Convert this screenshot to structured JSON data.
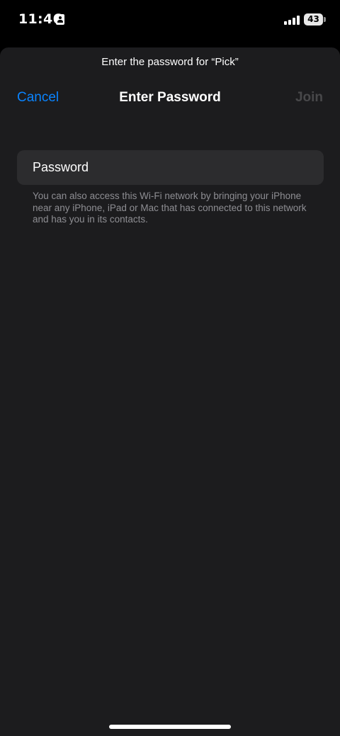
{
  "status_bar": {
    "time": "11:46",
    "battery_level": "43",
    "icons": [
      "contact-card-icon",
      "cellular-signal-icon",
      "battery-icon"
    ]
  },
  "sheet": {
    "prompt": "Enter the password for “Pick”",
    "nav": {
      "cancel_label": "Cancel",
      "title": "Enter Password",
      "join_label": "Join"
    },
    "password_field": {
      "placeholder": "Password",
      "value": ""
    },
    "footnote": "You can also access this Wi-Fi network by bringing your iPhone near any iPhone, iPad or Mac that has connected to this network and has you in its contacts."
  },
  "colors": {
    "accent": "#0a84ff",
    "sheet_background": "#1c1c1e",
    "field_background": "#2c2c2e",
    "disabled_text": "#48484a",
    "secondary_text": "#8e8e93"
  }
}
